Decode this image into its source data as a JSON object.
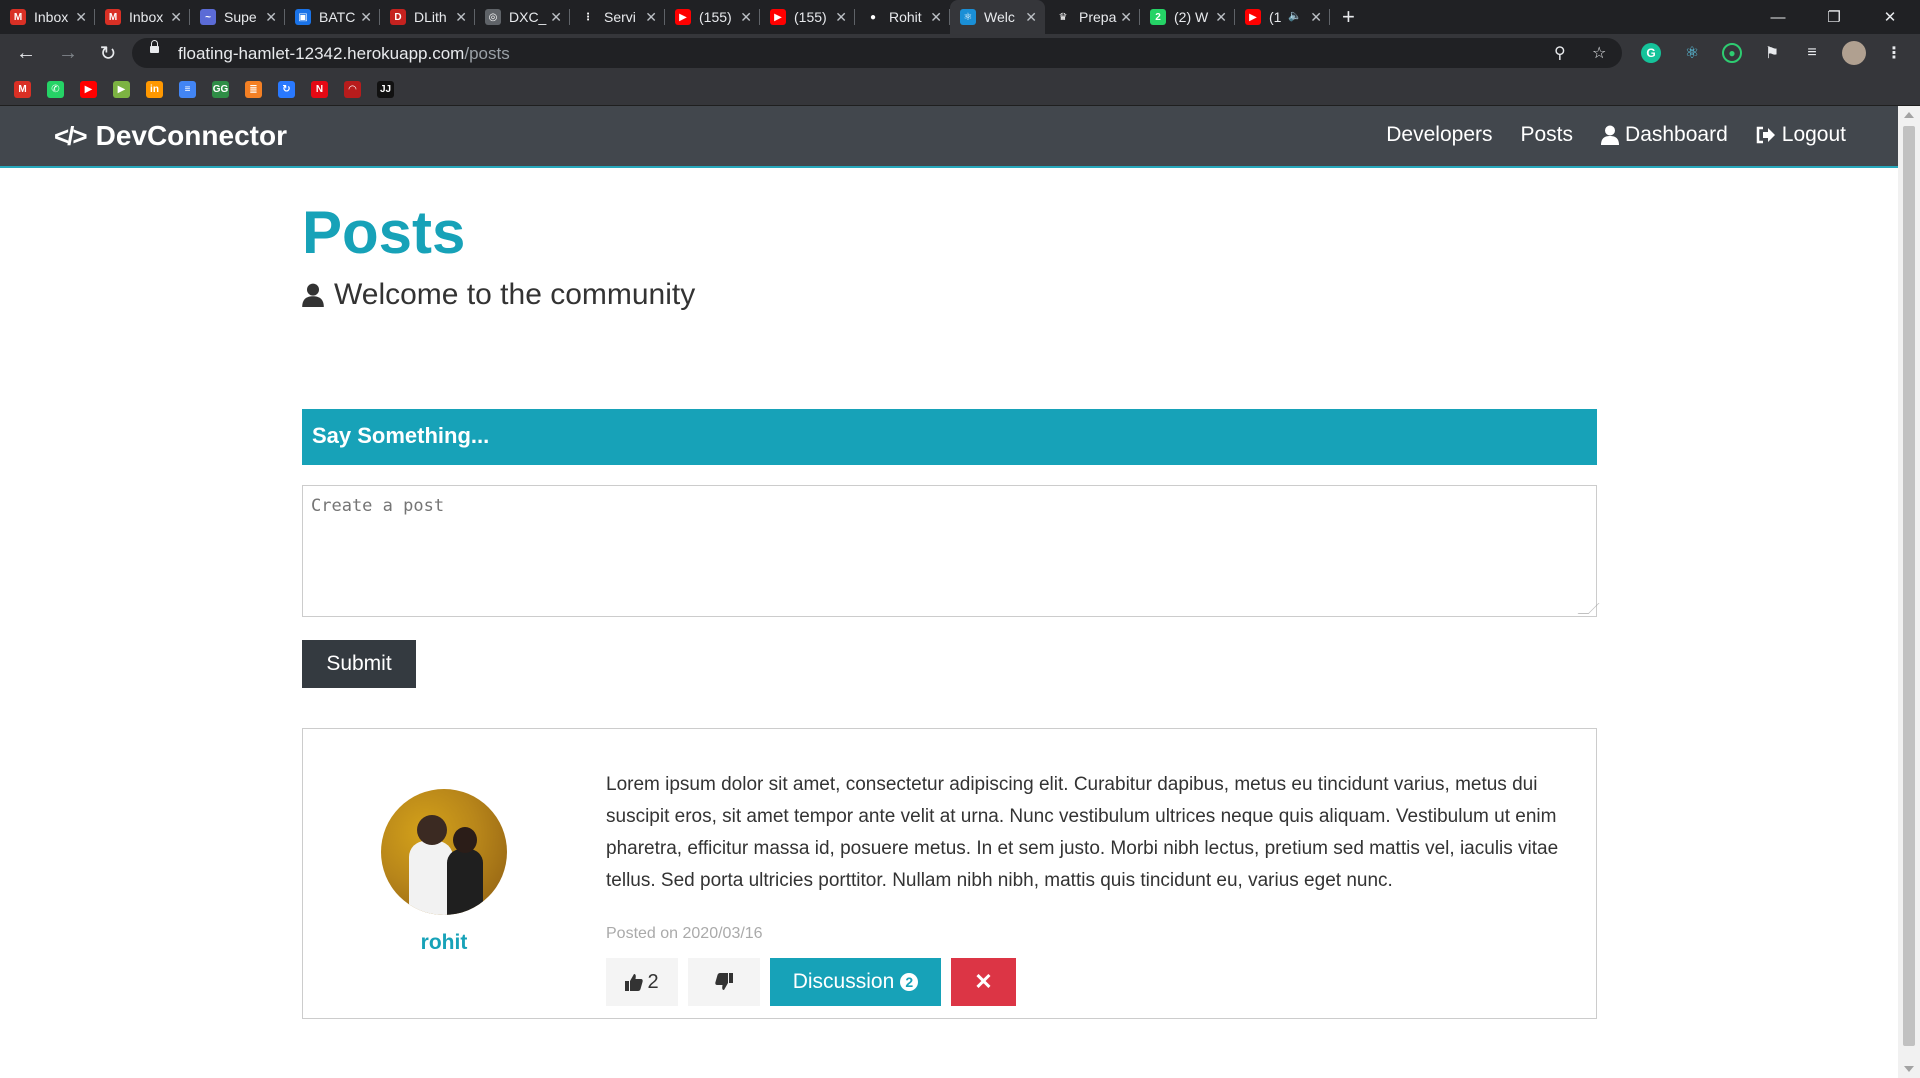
{
  "browser": {
    "tabs": [
      {
        "label": "Inbox",
        "icon": "gmail-icon",
        "color": "#d93025",
        "glyph": "M"
      },
      {
        "label": "Inbox",
        "icon": "gmail-icon",
        "color": "#d93025",
        "glyph": "M"
      },
      {
        "label": "Supe",
        "icon": "supercoder-icon",
        "color": "#5b6bd6",
        "glyph": "~"
      },
      {
        "label": "BATC",
        "icon": "contact-card-icon",
        "color": "#1a73e8",
        "glyph": "▣"
      },
      {
        "label": "DLith",
        "icon": "dlith-icon",
        "color": "#c5221f",
        "glyph": "D"
      },
      {
        "label": "DXC_",
        "icon": "globe-icon",
        "color": "#5f6368",
        "glyph": "◎"
      },
      {
        "label": "Servi",
        "icon": "service-icon",
        "color": "#202124",
        "glyph": "⋮"
      },
      {
        "label": "(155)",
        "icon": "youtube-icon",
        "color": "#ff0000",
        "glyph": "▶"
      },
      {
        "label": "(155)",
        "icon": "youtube-icon",
        "color": "#ff0000",
        "glyph": "▶"
      },
      {
        "label": "Rohit",
        "icon": "github-icon",
        "color": "#202124",
        "glyph": "●"
      },
      {
        "label": "Welc",
        "icon": "react-icon",
        "color": "#1a8fd6",
        "glyph": "⚛",
        "active": true
      },
      {
        "label": "Prepa",
        "icon": "trophy-icon",
        "color": "#202124",
        "glyph": "♛"
      },
      {
        "label": "(2) W",
        "icon": "whatsapp-icon",
        "color": "#25d366",
        "glyph": "2"
      },
      {
        "label": "(1",
        "icon": "youtube-icon",
        "color": "#ff0000",
        "glyph": "▶",
        "audio": true
      }
    ],
    "url_host": "floating-hamlet-12342.herokuapp.com",
    "url_path": "/posts",
    "bookmarks": [
      {
        "icon": "gmail-icon",
        "color": "#d93025",
        "glyph": "M"
      },
      {
        "icon": "whatsapp-icon",
        "color": "#25d366",
        "glyph": "✆"
      },
      {
        "icon": "youtube-icon",
        "color": "#ff0000",
        "glyph": "▶"
      },
      {
        "icon": "play-icon",
        "color": "#7cb342",
        "glyph": "▶"
      },
      {
        "icon": "linkedin-icon",
        "color": "#ff9800",
        "glyph": "in"
      },
      {
        "icon": "docs-icon",
        "color": "#4285f4",
        "glyph": "≡"
      },
      {
        "icon": "geeksforgeeks-icon",
        "color": "#2f8d46",
        "glyph": "GG"
      },
      {
        "icon": "hackerrank-icon",
        "color": "#f48024",
        "glyph": "≣"
      },
      {
        "icon": "refresh-arrow-icon",
        "color": "#2979ff",
        "glyph": "↻"
      },
      {
        "icon": "netflix-icon",
        "color": "#e50914",
        "glyph": "N"
      },
      {
        "icon": "speedometer-icon",
        "color": "#b71c1c",
        "glyph": "◠"
      },
      {
        "icon": "jj-icon",
        "color": "#111111",
        "glyph": "JJ"
      }
    ]
  },
  "navbar": {
    "brand": "DevConnector",
    "links": [
      {
        "label": "Developers"
      },
      {
        "label": "Posts"
      },
      {
        "label": "Dashboard",
        "icon": "user-icon"
      },
      {
        "label": "Logout",
        "icon": "sign-out-icon"
      }
    ]
  },
  "page": {
    "title": "Posts",
    "lead": "Welcome to the community",
    "form_header": "Say Something...",
    "textarea_placeholder": "Create a post",
    "submit_label": "Submit"
  },
  "post": {
    "author": "rohit",
    "text": "Lorem ipsum dolor sit amet, consectetur adipiscing elit. Curabitur dapibus, metus eu tincidunt varius, metus dui suscipit eros, sit amet tempor ante velit at urna. Nunc vestibulum ultrices neque quis aliquam. Vestibulum ut enim pharetra, efficitur massa id, posuere metus. In et sem justo. Morbi nibh lectus, pretium sed mattis vel, iaculis vitae tellus. Sed porta ultricies porttitor. Nullam nibh nibh, mattis quis tincidunt eu, varius eget nunc.",
    "date": "Posted on 2020/03/16",
    "likes": "2",
    "discussion_label": "Discussion",
    "comment_count": "2",
    "delete_glyph": "✕"
  },
  "colors": {
    "primary": "#17a2b8",
    "dark": "#343a40",
    "danger": "#dc3545",
    "light": "#f4f4f4"
  }
}
